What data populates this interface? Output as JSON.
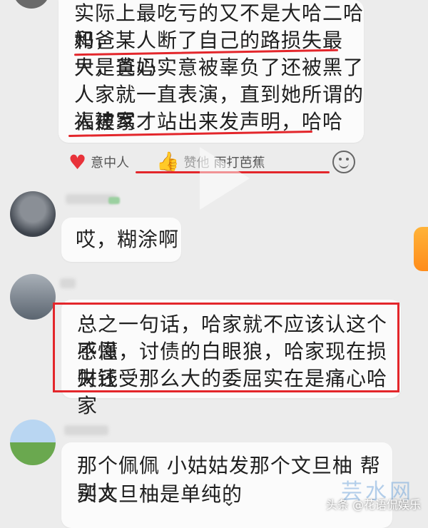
{
  "messages": [
    {
      "lines": [
        "实际上最吃亏的又不是大哈二哈和爸",
        "妈，某人断了自己的路损失最大，爸妈",
        "只是真心实意被辜负了还被黑了",
        "人家就一直表演，直到她所谓的福建家",
        "人被骂才站出来发声明，哈哈"
      ]
    },
    {
      "lines": [
        "哎，糊涂啊"
      ]
    },
    {
      "lines": [
        "总之一句话，哈家就不应该认这个不懂",
        "感恩，讨债的白眼狼，哈家现在损失钱",
        "财还受那么大的委屈实在是痛心哈家"
      ]
    },
    {
      "lines": [
        "那个佩佩 小姑姑发那个文旦柚 帮别人",
        "买文旦柚是单纯的"
      ]
    }
  ],
  "reactions": {
    "heart_label": "意中人",
    "thumbs_label": "雨打芭蕉",
    "thumbs_prefix": "赞他"
  },
  "watermark": {
    "site": "芸水网",
    "source": "头条 @花语侃娱乐"
  },
  "colors": {
    "highlight_red": "#e3262b",
    "heart": "#e8323a",
    "thumb": "#f4b400"
  }
}
